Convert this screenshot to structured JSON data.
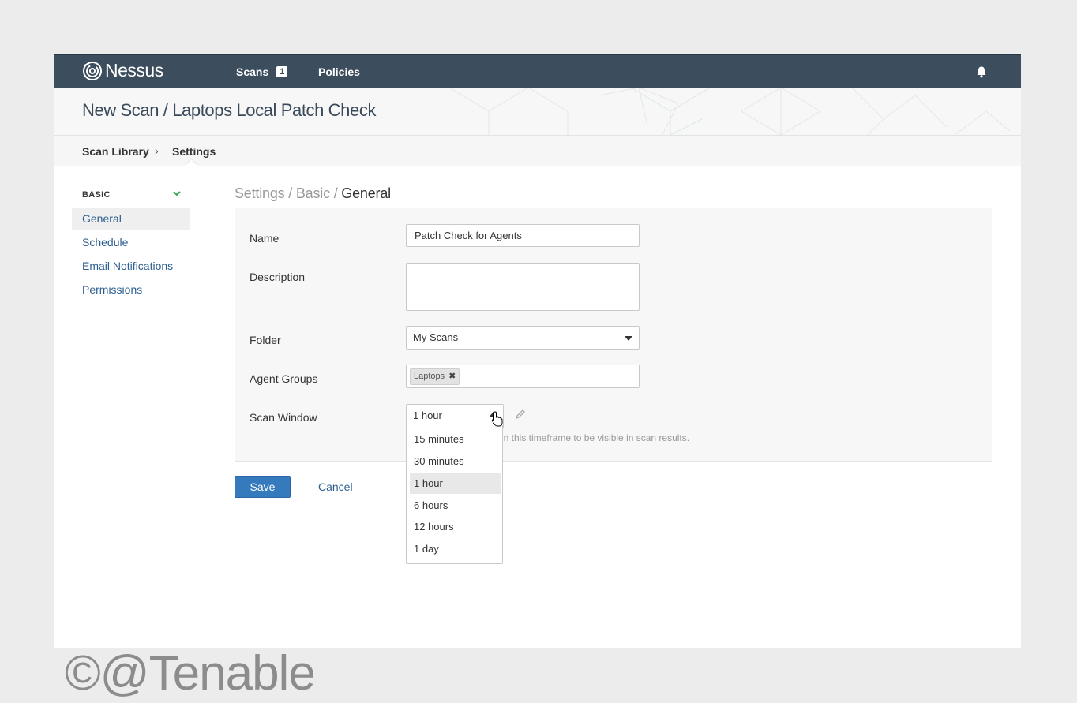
{
  "header": {
    "logo_text": "Nessus",
    "nav": [
      {
        "label": "Scans",
        "badge": "1"
      },
      {
        "label": "Policies"
      }
    ]
  },
  "page": {
    "title": "New Scan / Laptops Local Patch Check"
  },
  "breadcrumb": {
    "items": [
      "Scan Library",
      "Settings"
    ],
    "separator": "›"
  },
  "sidebar": {
    "section": "BASIC",
    "items": [
      "General",
      "Schedule",
      "Email Notifications",
      "Permissions"
    ],
    "active": "General"
  },
  "section_title": {
    "parts": [
      "Settings",
      "Basic",
      "General"
    ],
    "separator": " / "
  },
  "form": {
    "name": {
      "label": "Name",
      "value": "Patch Check for Agents"
    },
    "description": {
      "label": "Description",
      "value": ""
    },
    "folder": {
      "label": "Folder",
      "value": "My Scans"
    },
    "agent_groups": {
      "label": "Agent Groups",
      "tags": [
        "Laptops"
      ]
    },
    "scan_window": {
      "label": "Scan Window",
      "value": "1 hour",
      "help_text_visible": "in this timeframe to be visible in scan results.",
      "options": [
        "15 minutes",
        "30 minutes",
        "1 hour",
        "6 hours",
        "12 hours",
        "1 day"
      ],
      "selected": "1 hour"
    }
  },
  "actions": {
    "save": "Save",
    "cancel": "Cancel"
  },
  "watermark": "©@Tenable",
  "colors": {
    "topbar": "#3c4d5e",
    "primary": "#357abd",
    "link": "#2b5e90",
    "accent_green": "#3aa655"
  }
}
